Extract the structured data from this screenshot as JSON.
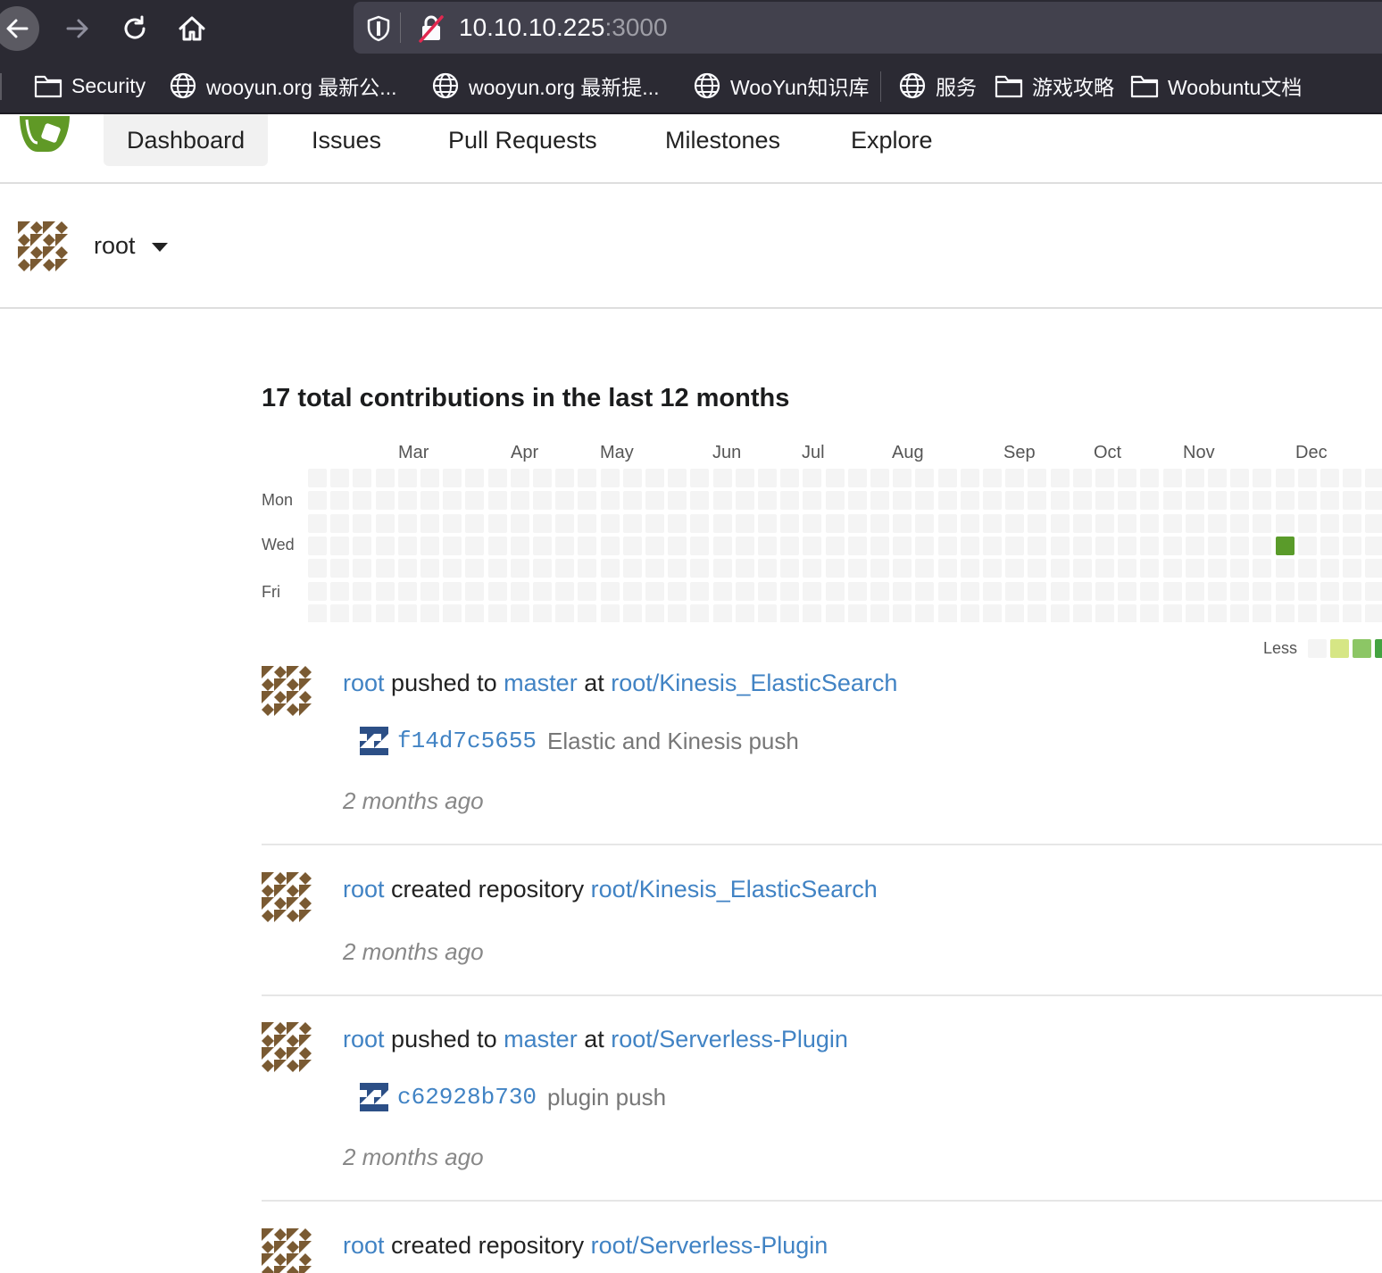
{
  "browser": {
    "url_host": "10.10.10.225",
    "url_port": ":3000"
  },
  "bookmarks": [
    {
      "label": "Security",
      "icon": "folder-icon"
    },
    {
      "label": "wooyun.org 最新公...",
      "icon": "globe-icon"
    },
    {
      "label": "wooyun.org 最新提...",
      "icon": "globe-icon"
    },
    {
      "label": "WooYun知识库",
      "icon": "globe-icon"
    },
    {
      "label": "服务",
      "icon": "globe-icon"
    },
    {
      "label": "游戏攻略",
      "icon": "folder-icon"
    },
    {
      "label": "Woobuntu文档",
      "icon": "folder-icon"
    }
  ],
  "nav": {
    "items": [
      "Dashboard",
      "Issues",
      "Pull Requests",
      "Milestones",
      "Explore"
    ],
    "active": "Dashboard"
  },
  "context": {
    "username": "root"
  },
  "heatmap": {
    "title": "17 total contributions in the last 12 months",
    "months": [
      "Mar",
      "Apr",
      "May",
      "Jun",
      "Jul",
      "Aug",
      "Sep",
      "Oct",
      "Nov",
      "Dec"
    ],
    "days": [
      "Mon",
      "Wed",
      "Fri"
    ],
    "legend_less": "Less",
    "colors": {
      "empty": "#f4f4f4",
      "l1": "#d6e685",
      "l2": "#8cc665",
      "l3": "#44a340",
      "active": "#5a9b2a"
    }
  },
  "feed": [
    {
      "user": "root",
      "action": "pushed to",
      "branch": "master",
      "at": "at",
      "repo": "root/Kinesis_ElasticSearch",
      "commit": {
        "sha": "f14d7c5655",
        "message": "Elastic and Kinesis push"
      },
      "time": "2 months ago"
    },
    {
      "user": "root",
      "action": "created repository",
      "repo": "root/Kinesis_ElasticSearch",
      "time": "2 months ago"
    },
    {
      "user": "root",
      "action": "pushed to",
      "branch": "master",
      "at": "at",
      "repo": "root/Serverless-Plugin",
      "commit": {
        "sha": "c62928b730",
        "message": "plugin push"
      },
      "time": "2 months ago"
    },
    {
      "user": "root",
      "action": "created repository",
      "repo": "root/Serverless-Plugin"
    }
  ]
}
